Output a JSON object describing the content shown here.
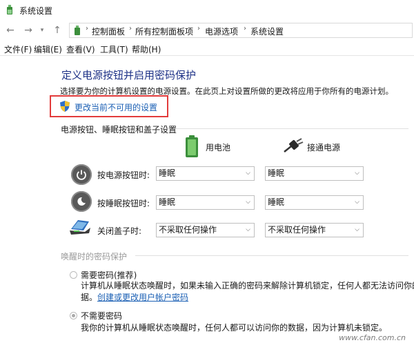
{
  "window": {
    "title": "系统设置"
  },
  "nav": {
    "back_icon": "back-arrow-icon",
    "forward_icon": "forward-arrow-icon",
    "up_icon": "up-arrow-icon",
    "breadcrumbs": [
      "控制面板",
      "所有控制面板项",
      "电源选项",
      "系统设置"
    ]
  },
  "menu": [
    "文件(F)",
    "编辑(E)",
    "查看(V)",
    "工具(T)",
    "帮助(H)"
  ],
  "page": {
    "title": "定义电源按钮并启用密码保护",
    "description": "选择要为你的计算机设置的电源设置。在此页上对设置所做的更改将应用于你所有的电源计划。",
    "change_link": "更改当前不可用的设置",
    "highlight_color": "#e23b3b"
  },
  "power_section": {
    "heading": "电源按钮、睡眠按钮和盖子设置",
    "columns": [
      "用电池",
      "接通电源"
    ],
    "rows": [
      {
        "label": "按电源按钮时:",
        "battery": "睡眠",
        "plugged": "睡眠",
        "icon": "power-button-icon"
      },
      {
        "label": "按睡眠按钮时:",
        "battery": "睡眠",
        "plugged": "睡眠",
        "icon": "sleep-button-icon"
      },
      {
        "label": "关闭盖子时:",
        "battery": "不采取任何操作",
        "plugged": "不采取任何操作",
        "icon": "laptop-lid-icon"
      }
    ]
  },
  "password_section": {
    "heading": "唤醒时的密码保护",
    "option1": {
      "label": "需要密码(推荐)",
      "text1": "计算机从睡眠状态唤醒时，如果未输入正确的密码来解除计算机锁定，任何人都无法访问你的数",
      "text2": "据。",
      "link": "创建或更改用户帐户密码",
      "selected": false
    },
    "option2": {
      "label": "不需要密码",
      "text": "我你的计算机从睡眠状态唤醒时，任何人都可以访问你的数据，因为计算机未锁定。",
      "selected": true
    }
  },
  "watermark": "www.cfan.com.cn"
}
